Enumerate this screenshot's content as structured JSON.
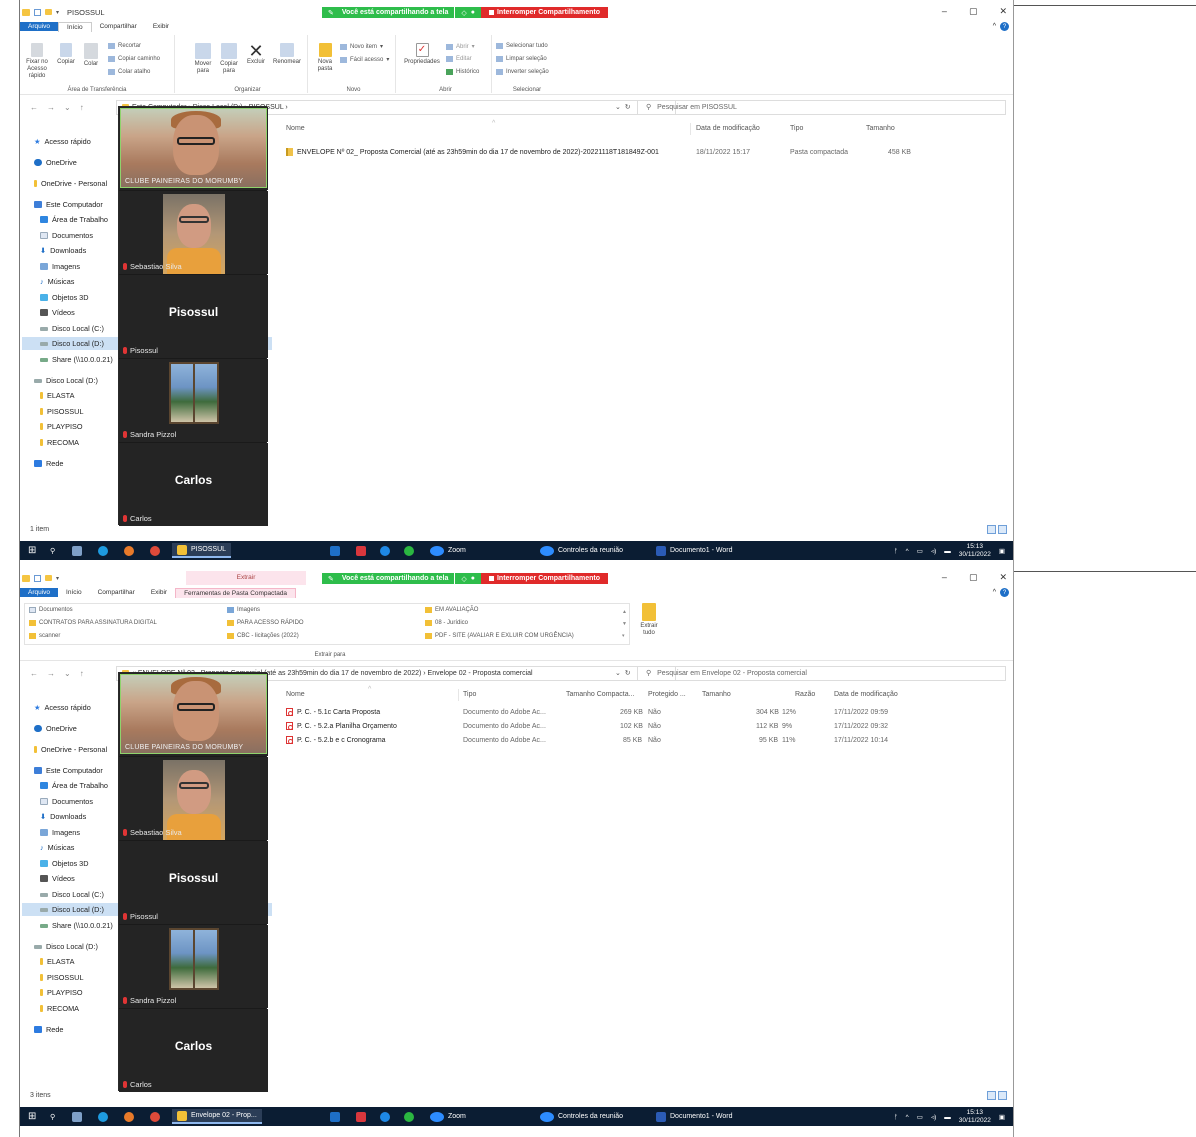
{
  "screens": [
    {
      "title": "PISOSSUL",
      "share_bar": {
        "sharing_text": "Você está compartilhando a tela",
        "stop_text": "Interromper Compartilhamento"
      },
      "tabs": [
        "Arquivo",
        "Início",
        "Compartilhar",
        "Exibir"
      ],
      "ribbon": {
        "clipboard": {
          "label": "Área de Transferência",
          "pin": "Fixar no Acesso rápido",
          "copy": "Copiar",
          "paste": "Colar",
          "cut": "Recortar",
          "copy_path": "Copiar caminho",
          "paste_shortcut": "Colar atalho"
        },
        "organize": {
          "label": "Organizar",
          "move": "Mover para",
          "copy_to": "Copiar para",
          "delete": "Excluir",
          "rename": "Renomear"
        },
        "new": {
          "label": "Novo",
          "new_folder": "Nova pasta",
          "new_item": "Novo item",
          "easy_access": "Fácil acesso"
        },
        "open": {
          "label": "Abrir",
          "properties": "Propriedades",
          "open": "Abrir",
          "edit": "Editar",
          "history": "Histórico"
        },
        "select": {
          "label": "Selecionar",
          "select_all": "Selecionar tudo",
          "clear": "Limpar seleção",
          "invert": "Inverter seleção"
        }
      },
      "address": {
        "crumbs": "Este Computador  ›  Disco Local (D:)  ›  PISOSSUL  ›",
        "search_placeholder": "Pesquisar em PISOSSUL"
      },
      "columns": [
        "Nome",
        "Data de modificação",
        "Tipo",
        "Tamanho"
      ],
      "files": [
        {
          "name": "ENVELOPE Nº 02_ Proposta Comercial (até as 23h59min do dia 17 de novembro de 2022)-20221118T181849Z-001",
          "date": "18/11/2022 15:17",
          "type": "Pasta compactada",
          "size": "458 KB"
        }
      ],
      "status": "1 item",
      "taskbar_app": "PISOSSUL"
    },
    {
      "title": "",
      "share_bar": {
        "sharing_text": "Você está compartilhando a tela",
        "stop_text": "Interromper Compartilhamento"
      },
      "tabs": [
        "Arquivo",
        "Início",
        "Compartilhar",
        "Exibir"
      ],
      "context_tab": {
        "top": "Extrair",
        "label": "Ferramentas de Pasta Compactada"
      },
      "extract_ribbon": {
        "items": [
          "Documentos",
          "CONTRATOS PARA ASSINATURA DIGITAL",
          "scanner",
          "Imagens",
          "PARA ACESSO RÁPIDO",
          "CBC - licitações (2022)",
          "EM AVALIAÇÃO",
          "08 - Jurídico",
          "PDF - SITE (AVALIAR E EXLUIR COM URGÊNCIA)"
        ],
        "extract_all": "Extrair tudo",
        "label": "Extrair para"
      },
      "address": {
        "crumbs": "«  ENVELOPE Nº 02_ Proposta Comercial (até as 23h59min do dia 17 de novembro de 2022)  ›  Envelope 02 - Proposta comercial",
        "search_placeholder": "Pesquisar em Envelope 02 - Proposta comercial"
      },
      "columns": [
        "Nome",
        "Tipo",
        "Tamanho Compacta...",
        "Protegido ...",
        "Tamanho",
        "Razão",
        "Data de modificação"
      ],
      "files": [
        {
          "name": "P. C. - 5.1c Carta Proposta",
          "type": "Documento do Adobe Ac...",
          "csize": "269 KB",
          "prot": "Não",
          "size": "304 KB",
          "ratio": "12%",
          "date": "17/11/2022 09:59"
        },
        {
          "name": "P. C. - 5.2.a Planilha Orçamento",
          "type": "Documento do Adobe Ac...",
          "csize": "102 KB",
          "prot": "Não",
          "size": "112 KB",
          "ratio": "9%",
          "date": "17/11/2022 09:32"
        },
        {
          "name": "P. C. - 5.2.b e c Cronograma",
          "type": "Documento do Adobe Ac...",
          "csize": "85 KB",
          "prot": "Não",
          "size": "95 KB",
          "ratio": "11%",
          "date": "17/11/2022 10:14"
        }
      ],
      "status": "3 itens",
      "taskbar_app": "Envelope 02 - Prop..."
    }
  ],
  "sidebar": {
    "quick_access": "Acesso rápido",
    "onedrive": "OneDrive",
    "onedrive_personal": "OneDrive - Personal",
    "this_pc": "Este Computador",
    "desktop": "Área de Trabalho",
    "documents": "Documentos",
    "downloads": "Downloads",
    "images": "Imagens",
    "music": "Músicas",
    "objects3d": "Objetos 3D",
    "videos": "Vídeos",
    "disk_c": "Disco Local (C:)",
    "disk_d": "Disco Local (D:)",
    "share": "Share (\\\\10.0.0.21)",
    "disk_d2": "Disco Local (D:)",
    "f_elasta": "ELASTA",
    "f_pisossul": "PISOSSUL",
    "f_playpiso": "PLAYPISO",
    "f_recoma": "RECOMA",
    "network": "Rede"
  },
  "zoom": {
    "p1_label": "CLUBE PAINEIRAS DO MORUMBY",
    "p2": "Sebastiao Silva",
    "p3_big": "Pisossul",
    "p3": "Pisossul",
    "p4": "Sandra Pizzol",
    "p5_big": "Carlos",
    "p5": "Carlos"
  },
  "taskbar": {
    "zoom": "Zoom",
    "controls": "Controles da reunião",
    "word": "Documento1 - Word",
    "time": "15:13",
    "date": "30/11/2022"
  },
  "colors": {
    "accent": "#1e6fc7",
    "share_green": "#2ebd4b",
    "share_red": "#e02a2a",
    "taskbar": "#0b1d33"
  }
}
